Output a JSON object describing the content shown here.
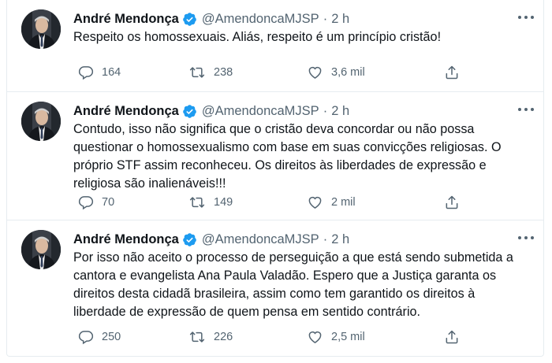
{
  "tweets": [
    {
      "author_name": "André Mendonça",
      "handle": "@AmendoncaMJSP",
      "separator": "·",
      "time": "2 h",
      "text": "Respeito os homossexuais. Aliás, respeito é um princípio cristão!",
      "replies": "164",
      "retweets": "238",
      "likes": "3,6 mil"
    },
    {
      "author_name": "André Mendonça",
      "handle": "@AmendoncaMJSP",
      "separator": "·",
      "time": "2 h",
      "text": "Contudo, isso não significa que o cristão deva concordar ou não possa questionar o homossexualismo com base em suas convicções religiosas. O próprio STF assim reconheceu. Os direitos às liberdades de expressão e religiosa são inalienáveis!!!",
      "replies": "70",
      "retweets": "149",
      "likes": "2 mil"
    },
    {
      "author_name": "André Mendonça",
      "handle": "@AmendoncaMJSP",
      "separator": "·",
      "time": "2 h",
      "text": "Por isso não aceito o processo de perseguição a que está sendo submetida a cantora e evangelista Ana Paula Valadão. Espero que a Justiça garanta os direitos desta cidadã brasileira, assim como tem garantido os direitos à liberdade de expressão de quem pensa em sentido contrário.",
      "replies": "250",
      "retweets": "226",
      "likes": "2,5 mil"
    }
  ],
  "icons": {
    "verified": "verified-badge-icon",
    "more": "more-options-icon",
    "reply": "reply-icon",
    "retweet": "retweet-icon",
    "like": "like-icon",
    "share": "share-icon"
  },
  "colors": {
    "verified": "#1d9bf0",
    "text": "#0f1419",
    "secondary": "#536471",
    "divider": "#e6ecf0"
  }
}
